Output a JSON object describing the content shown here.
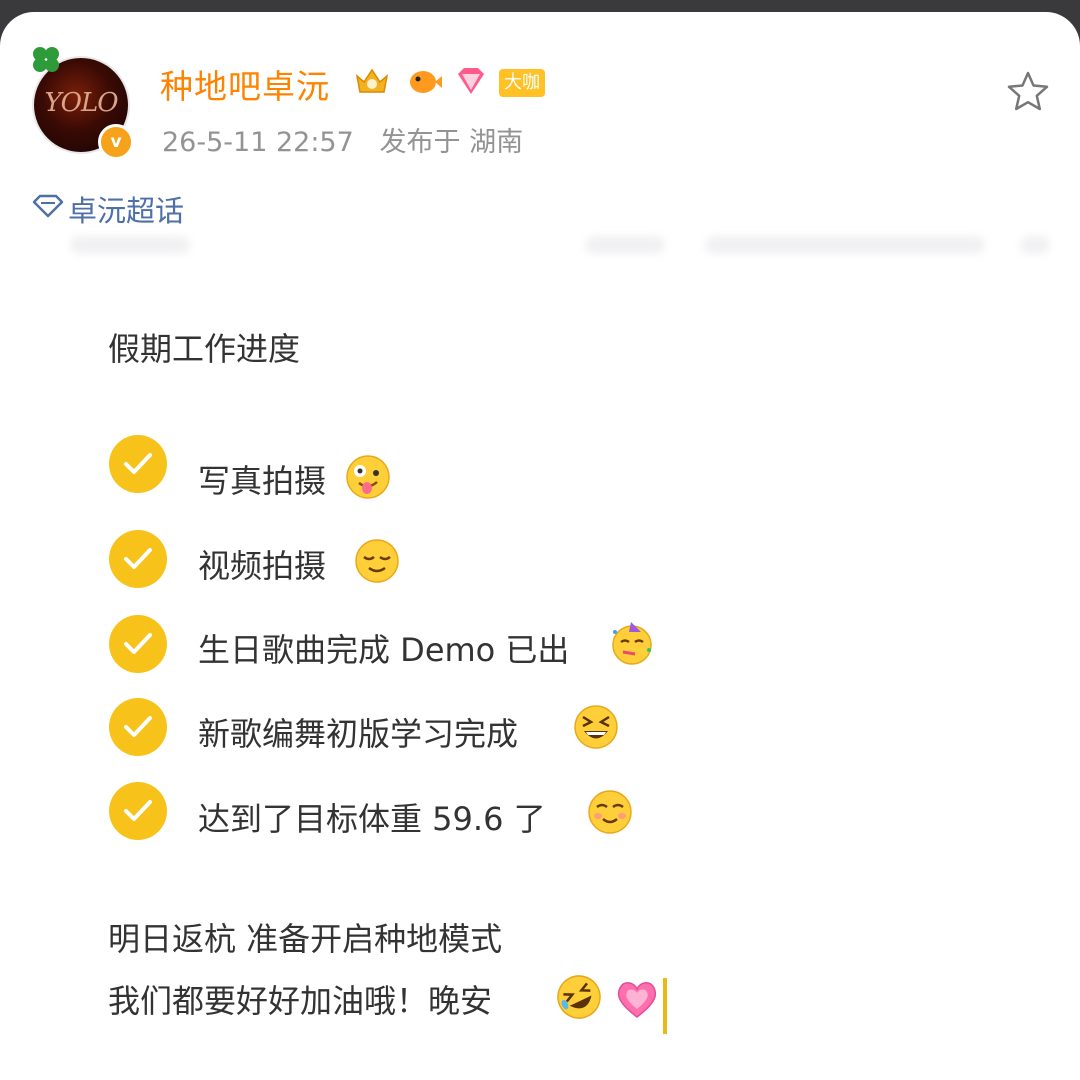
{
  "post": {
    "username": "种地吧卓沅",
    "badge_label": "大咖",
    "timestamp": "26-5-11 22:57",
    "location": "发布于 湖南",
    "avatar_text": "YOLO",
    "verified_mark": "v",
    "topic": "卓沅超话",
    "title": "假期工作进度",
    "checklist": [
      {
        "text": "写真拍摄",
        "emoji": "zany-face"
      },
      {
        "text": "视频拍摄",
        "emoji": "relieved-face"
      },
      {
        "text": "生日歌曲完成 Demo 已出",
        "emoji": "partying-face"
      },
      {
        "text": "新歌编舞初版学习完成",
        "emoji": "grinning-squinting-face"
      },
      {
        "text": "达到了目标体重 59.6 了",
        "emoji": "smiling-face"
      }
    ],
    "closing_line_1": "明日返杭 准备开启种地模式",
    "closing_line_2": "我们都要好好加油哦！晚安",
    "closing_emojis": [
      "rolling-laughing-face",
      "growing-heart"
    ]
  },
  "icons": {
    "favorite": "star-outline-icon",
    "topic": "diamond-icon",
    "check": "check-circle-icon"
  },
  "colors": {
    "username": "#ff8200",
    "meta": "#939393",
    "topic": "#4f6fa8",
    "check": "#f7c21a",
    "verified": "#f6a21a",
    "badge": "#ffc126"
  }
}
